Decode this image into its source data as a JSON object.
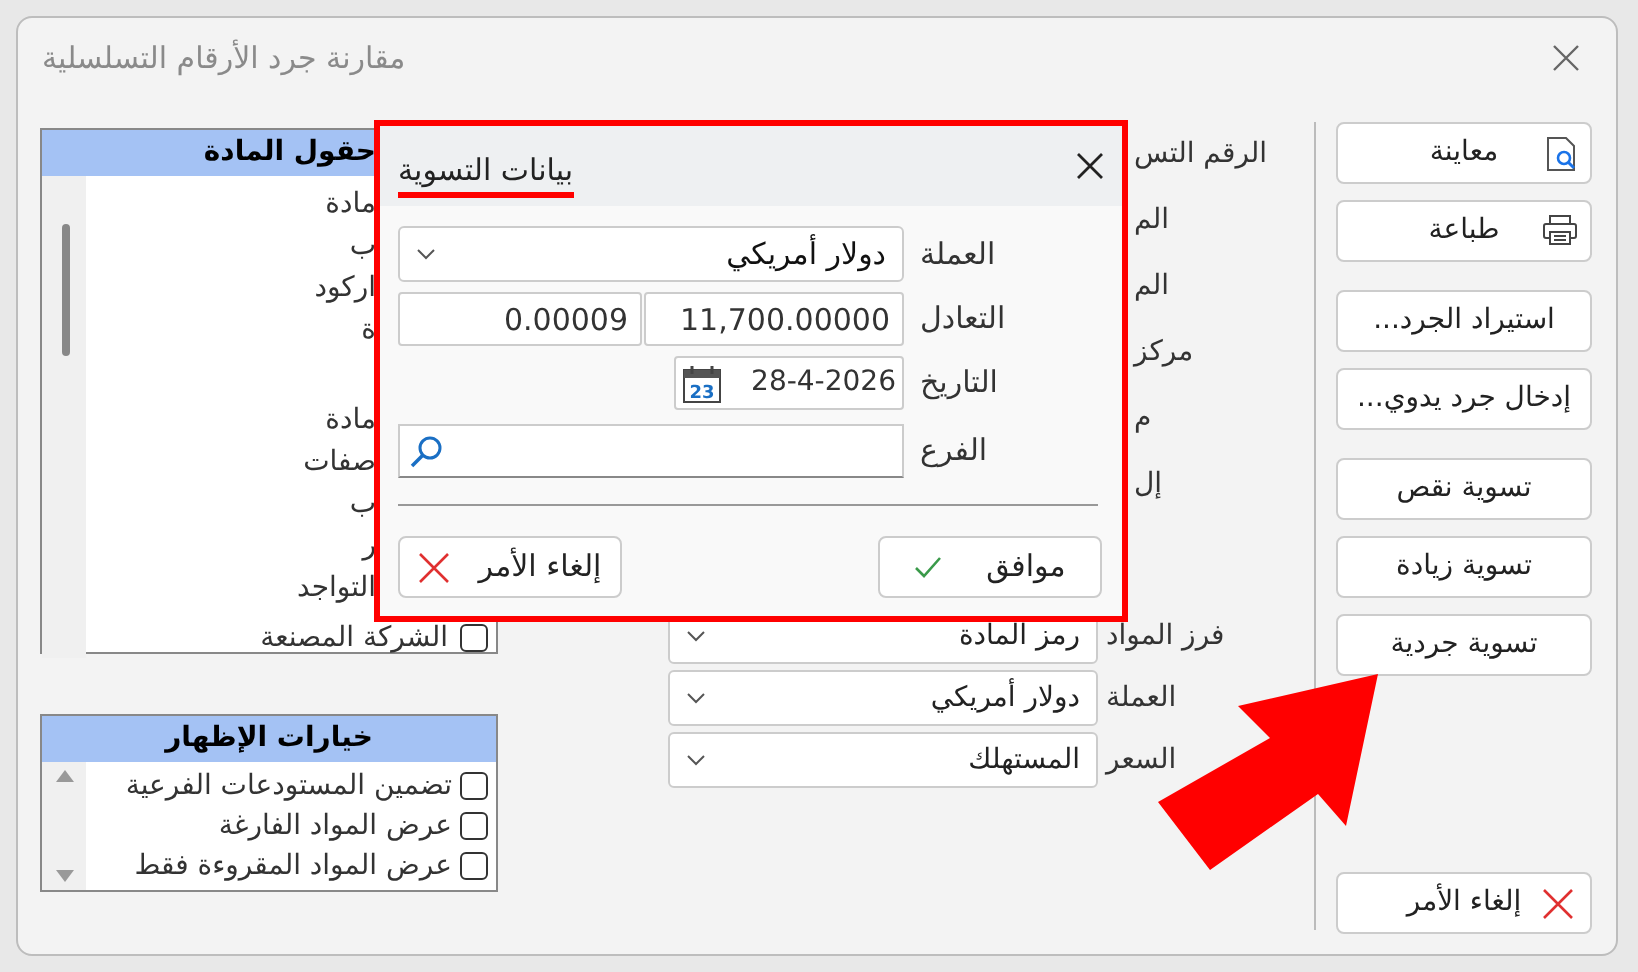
{
  "window": {
    "title": "مقارنة جرد الأرقام التسلسلية"
  },
  "fields_panel": {
    "title": "حقول المادة",
    "items": [
      {
        "label": "مادة",
        "kind": "partial"
      },
      {
        "label": "ب",
        "kind": "partial"
      },
      {
        "label": "اركود",
        "kind": "partial"
      },
      {
        "label": "ة",
        "kind": "partial"
      },
      {
        "label": "مادة",
        "kind": "partial"
      },
      {
        "label": "صفات",
        "kind": "partial"
      },
      {
        "label": "ب",
        "kind": "partial"
      },
      {
        "label": "ر",
        "kind": "partial"
      },
      {
        "label": "التواجد",
        "kind": "partial"
      },
      {
        "label": "الشركة المصنعة",
        "kind": "checkbox",
        "checked": false
      }
    ]
  },
  "display_options": {
    "title": "خيارات الإظهار",
    "items": [
      {
        "label": "تضمين المستودعات الفرعية",
        "checked": false
      },
      {
        "label": "عرض المواد الفارغة",
        "checked": false
      },
      {
        "label": "عرض المواد المقروءة فقط",
        "checked": false
      }
    ]
  },
  "partial_labels": [
    "الرقم التس",
    "الم",
    "الم",
    "مركز",
    "م",
    "إل"
  ],
  "selects": [
    {
      "label": "فرز المواد",
      "value": "رمز المادة"
    },
    {
      "label": "العملة",
      "value": "دولار أمريكي"
    },
    {
      "label": "السعر",
      "value": "المستهلك"
    }
  ],
  "button_groups": [
    [
      {
        "label": "معاينة",
        "kind": "preview"
      },
      {
        "label": "طباعة",
        "kind": "print"
      }
    ],
    [
      {
        "label": "استيراد الجرد...",
        "kind": "plain"
      },
      {
        "label": "إدخال جرد يدوي...",
        "kind": "plain"
      }
    ],
    [
      {
        "label": "تسوية نقص",
        "kind": "plain"
      },
      {
        "label": "تسوية زيادة",
        "kind": "plain"
      },
      {
        "label": "تسوية جردية",
        "kind": "plain"
      }
    ]
  ],
  "cancel_button": "إلغاء الأمر",
  "dialog": {
    "title": "بيانات التسوية",
    "currency": {
      "label": "العملة",
      "value": "دولار أمريكي"
    },
    "rate": {
      "label": "التعادل",
      "value": "11,700.00000",
      "inverse": "0.00009"
    },
    "date": {
      "label": "التاريخ",
      "value": "28-4-2026",
      "icon_day": "23"
    },
    "branch": {
      "label": "الفرع"
    },
    "ok": "موافق",
    "cancel": "إلغاء الأمر"
  }
}
